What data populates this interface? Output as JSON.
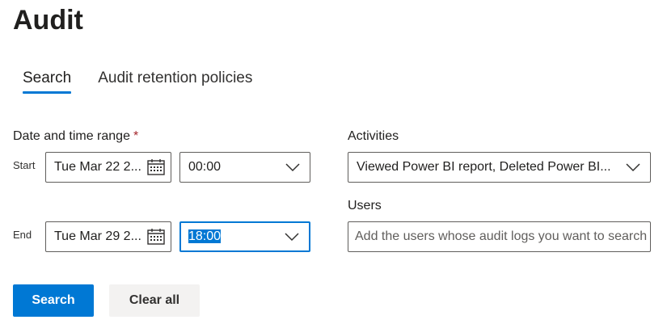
{
  "page": {
    "title": "Audit"
  },
  "tabs": [
    {
      "label": "Search",
      "active": true
    },
    {
      "label": "Audit retention policies",
      "active": false
    }
  ],
  "date_range": {
    "label": "Date and time range",
    "required_marker": "*",
    "start": {
      "label": "Start",
      "date": "Tue Mar 22 2...",
      "time": "00:00"
    },
    "end": {
      "label": "End",
      "date": "Tue Mar 29 2...",
      "time": "18:00"
    }
  },
  "activities": {
    "label": "Activities",
    "value": "Viewed Power BI report, Deleted Power BI..."
  },
  "users": {
    "label": "Users",
    "placeholder": "Add the users whose audit logs you want to search"
  },
  "buttons": {
    "search": "Search",
    "clear_all": "Clear all"
  },
  "colors": {
    "accent": "#0078d4",
    "required": "#a4262c",
    "secondary_button": "#f3f2f1"
  },
  "icons": {
    "date_picker": "calendar-icon",
    "dropdown": "chevron-down-icon"
  }
}
